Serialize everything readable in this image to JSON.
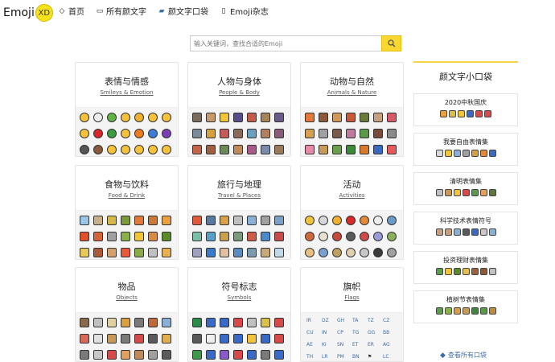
{
  "logo": {
    "text": "Emoji",
    "badge": "XD"
  },
  "nav": [
    {
      "label": "首页",
      "icon": "tag-icon"
    },
    {
      "label": "所有颜文字",
      "icon": "window-icon"
    },
    {
      "label": "颜文字口袋",
      "icon": "pocket-icon"
    },
    {
      "label": "Emoji杂志",
      "icon": "book-icon"
    }
  ],
  "search": {
    "placeholder": "输入关键词，查找合适的Emoji"
  },
  "categories": [
    {
      "title": "表情与情感",
      "subtitle": "Smileys & Emotion"
    },
    {
      "title": "人物与身体",
      "subtitle": "People & Body"
    },
    {
      "title": "动物与自然",
      "subtitle": "Animals & Nature"
    },
    {
      "title": "食物与饮料",
      "subtitle": "Food & Drink"
    },
    {
      "title": "旅行与地理",
      "subtitle": "Travel & Places"
    },
    {
      "title": "活动",
      "subtitle": "Activities"
    },
    {
      "title": "物品",
      "subtitle": "Objects"
    },
    {
      "title": "符号标志",
      "subtitle": "Symbols"
    },
    {
      "title": "旗帜",
      "subtitle": "Flags"
    }
  ],
  "flag_codes": [
    "IR",
    "DZ",
    "GH",
    "TA",
    "TZ",
    "CZ",
    "CU",
    "IN",
    "CP",
    "TG",
    "GG",
    "BB",
    "AE",
    "KI",
    "SN",
    "ET",
    "ER",
    "AG",
    "TH",
    "LR",
    "PM",
    "BN",
    "",
    "LC"
  ],
  "sidebar": {
    "title": "颜文字小口袋",
    "packs": [
      "2020中秋国庆",
      "我要自由表情集",
      "清明表情集",
      "科学技术表情符号",
      "投资理财表情集",
      "植树节表情集"
    ],
    "view_all": "查看所有口袋"
  },
  "colors": {
    "accent": "#f8d72e",
    "link": "#3b6ea8"
  }
}
